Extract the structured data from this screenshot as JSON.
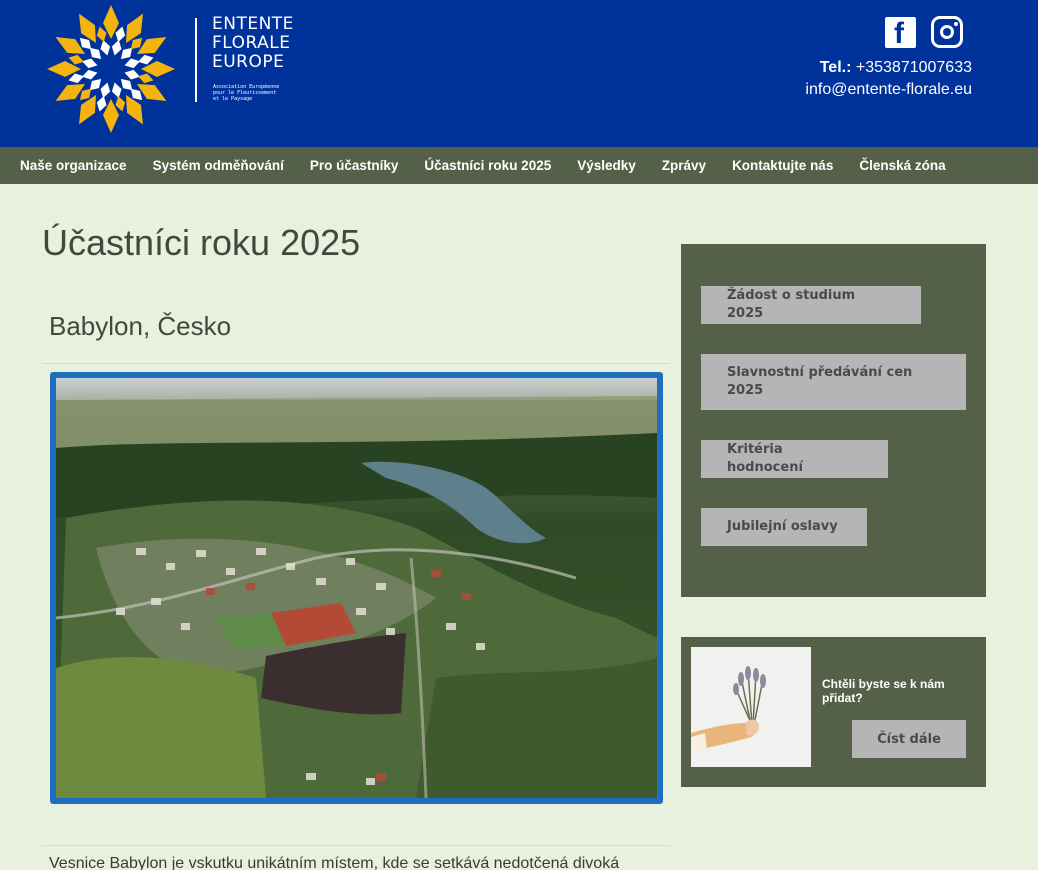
{
  "header": {
    "logo_lines": [
      "ENTENTE",
      "FLORALE",
      "EUROPE"
    ],
    "logo_subtitle": [
      "Association Européenne",
      "pour le Fleurissement",
      "et le Paysage"
    ],
    "tel_label": "Tel.:",
    "tel_value": "+353871007633",
    "email": "info@entente-florale.eu",
    "colors": {
      "header_bg": "#00329b",
      "star_yellow": "#f5b30d",
      "star_white": "#ffffff"
    },
    "icons": [
      "facebook-icon",
      "instagram-icon"
    ]
  },
  "nav": {
    "items": [
      "Naše organizace",
      "Systém odměňování",
      "Pro účastníky",
      "Účastníci roku 2025",
      "Výsledky",
      "Zprávy",
      "Kontaktujte nás",
      "Členská zóna"
    ]
  },
  "main": {
    "page_title": "Účastníci roku 2025",
    "section_title": "Babylon, Česko",
    "body_text": "Vesnice Babylon je vskutku unikátním místem, kde se setkává nedotčená divoká"
  },
  "sidebar": {
    "buttons": [
      "Žádost o studium 2025",
      "Slavnostní předávání cen 2025",
      "Kritéria hodnocení",
      "Jubilejní oslavy"
    ],
    "join_text": "Chtěli byste se k nám přidat?",
    "join_button": "Číst dále"
  }
}
